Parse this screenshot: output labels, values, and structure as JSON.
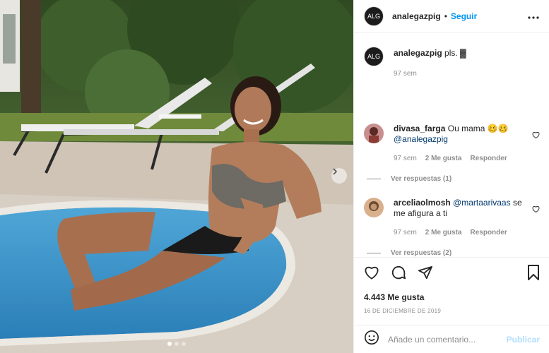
{
  "post": {
    "carousel_total": 3,
    "carousel_active": 1
  },
  "header": {
    "avatar_text": "ALG",
    "username": "analegazpig",
    "separator": "•",
    "follow_label": "Seguir",
    "more_icon": "more-horizontal-icon"
  },
  "caption": {
    "avatar_text": "ALG",
    "username": "analegazpig",
    "text": "pls. ▓",
    "time": "97 sem"
  },
  "comments": [
    {
      "username": "divasa_farga",
      "text": "Ou mama 🥴🥴",
      "mention": "@analegazpig",
      "time": "97 sem",
      "likes": "2 Me gusta",
      "reply_label": "Responder",
      "replies_label": "Ver respuestas (1)"
    },
    {
      "username": "arceliaolmosh",
      "mention": "@martaarivaas",
      "text": "se me afigura a ti",
      "time": "97 sem",
      "likes": "2 Me gusta",
      "reply_label": "Responder",
      "replies_label": "Ver respuestas (2)"
    }
  ],
  "actions": {
    "like_icon": "heart-icon",
    "comment_icon": "comment-icon",
    "share_icon": "share-icon",
    "save_icon": "bookmark-icon",
    "likes_count": "4.443 Me gusta",
    "date": "16 DE DICIEMBRE DE 2019"
  },
  "add_comment": {
    "placeholder": "Añade un comentario...",
    "post_label": "Publicar"
  },
  "colors": {
    "accent": "#0095f6",
    "publish_disabled": "#b2dffc",
    "muted": "#8e8e8e"
  }
}
